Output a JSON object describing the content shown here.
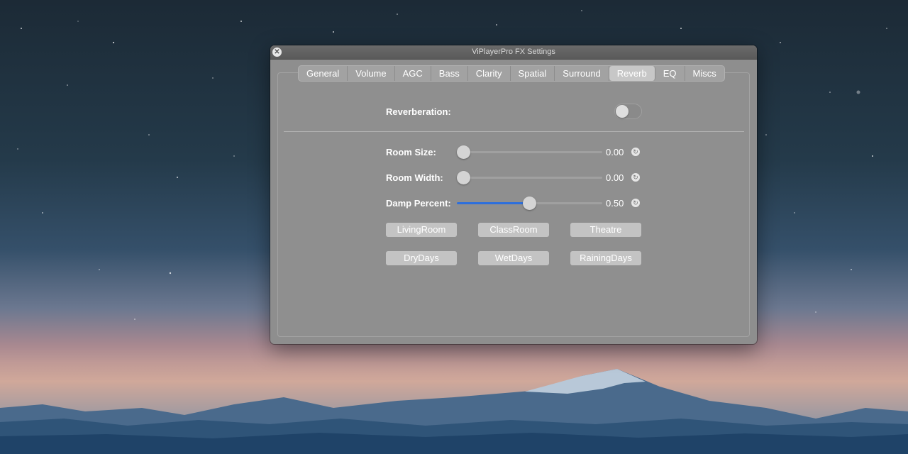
{
  "window": {
    "title": "ViPlayerPro FX Settings",
    "close_icon": "close-icon"
  },
  "tabs": [
    {
      "label": "General",
      "active": false
    },
    {
      "label": "Volume",
      "active": false
    },
    {
      "label": "AGC",
      "active": false
    },
    {
      "label": "Bass",
      "active": false
    },
    {
      "label": "Clarity",
      "active": false
    },
    {
      "label": "Spatial",
      "active": false
    },
    {
      "label": "Surround",
      "active": false
    },
    {
      "label": "Reverb",
      "active": true
    },
    {
      "label": "EQ",
      "active": false
    },
    {
      "label": "Miscs",
      "active": false
    }
  ],
  "reverb": {
    "toggle_label": "Reverberation:",
    "enabled": false,
    "sliders": [
      {
        "label": "Room Size:",
        "value": "0.00",
        "fraction": 0.0
      },
      {
        "label": "Room Width:",
        "value": "0.00",
        "fraction": 0.0
      },
      {
        "label": "Damp Percent:",
        "value": "0.50",
        "fraction": 0.5
      }
    ],
    "presets": [
      "LivingRoom",
      "ClassRoom",
      "Theatre",
      "DryDays",
      "WetDays",
      "RainingDays"
    ]
  },
  "colors": {
    "accent": "#2d6fdc",
    "window_bg": "#8e8e8e"
  }
}
